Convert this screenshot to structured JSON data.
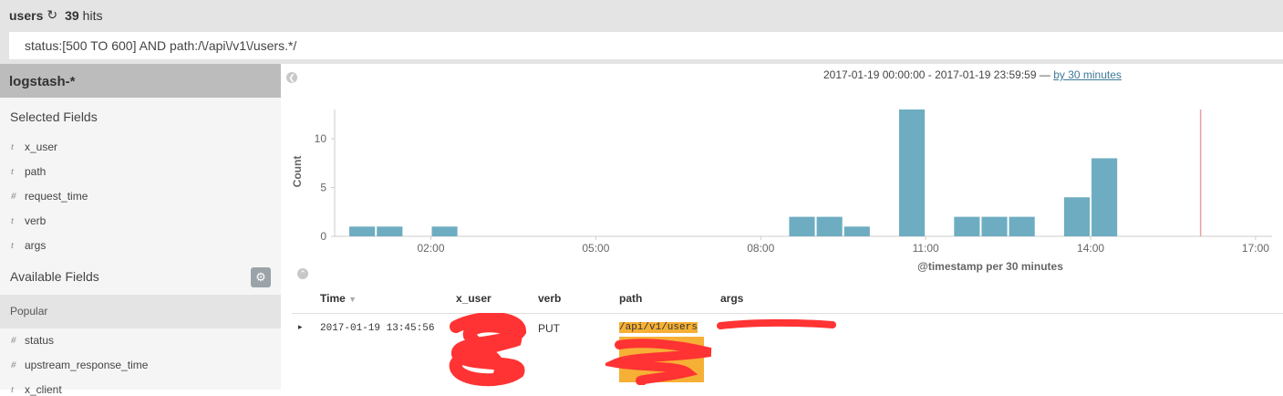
{
  "header": {
    "saved_search": "users",
    "hits_count": "39",
    "hits_label": "hits",
    "query": "status:[500 TO 600] AND path:/\\/api\\/v1\\/users.*/"
  },
  "sidebar": {
    "index_pattern": "logstash-*",
    "selected_title": "Selected Fields",
    "selected_fields": [
      {
        "type": "t",
        "name": "x_user"
      },
      {
        "type": "t",
        "name": "path"
      },
      {
        "type": "#",
        "name": "request_time"
      },
      {
        "type": "t",
        "name": "verb"
      },
      {
        "type": "t",
        "name": "args"
      }
    ],
    "available_title": "Available Fields",
    "popular_title": "Popular",
    "popular_fields": [
      {
        "type": "#",
        "name": "status"
      },
      {
        "type": "#",
        "name": "upstream_response_time"
      },
      {
        "type": "t",
        "name": "x_client"
      }
    ]
  },
  "time_range": {
    "text": "2017-01-19 00:00:00 - 2017-01-19 23:59:59 —",
    "interval_link": "by 30 minutes"
  },
  "chart_data": {
    "type": "bar",
    "xlabel": "@timestamp per 30 minutes",
    "ylabel": "Count",
    "x_ticks": [
      "02:00",
      "05:00",
      "08:00",
      "11:00",
      "14:00",
      "17:00"
    ],
    "y_ticks": [
      0,
      5,
      10
    ],
    "ylim": [
      0,
      13
    ],
    "bars": [
      {
        "start": "00:30",
        "value": 1
      },
      {
        "start": "01:00",
        "value": 1
      },
      {
        "start": "02:00",
        "value": 1
      },
      {
        "start": "08:30",
        "value": 2
      },
      {
        "start": "09:00",
        "value": 2
      },
      {
        "start": "09:30",
        "value": 1
      },
      {
        "start": "10:30",
        "value": 13
      },
      {
        "start": "11:30",
        "value": 2
      },
      {
        "start": "12:00",
        "value": 2
      },
      {
        "start": "12:30",
        "value": 2
      },
      {
        "start": "13:30",
        "value": 4
      },
      {
        "start": "14:00",
        "value": 8
      }
    ],
    "now_marker": "16:00",
    "bar_color": "#6eadc1",
    "marker_color": "#e8a0a0",
    "grid": false
  },
  "table": {
    "columns": [
      "Time",
      "x_user",
      "verb",
      "path",
      "args"
    ],
    "rows": [
      {
        "time": "2017-01-19 13:45:56",
        "verb": "PUT",
        "path_visible": "/api/v1/users"
      }
    ]
  }
}
